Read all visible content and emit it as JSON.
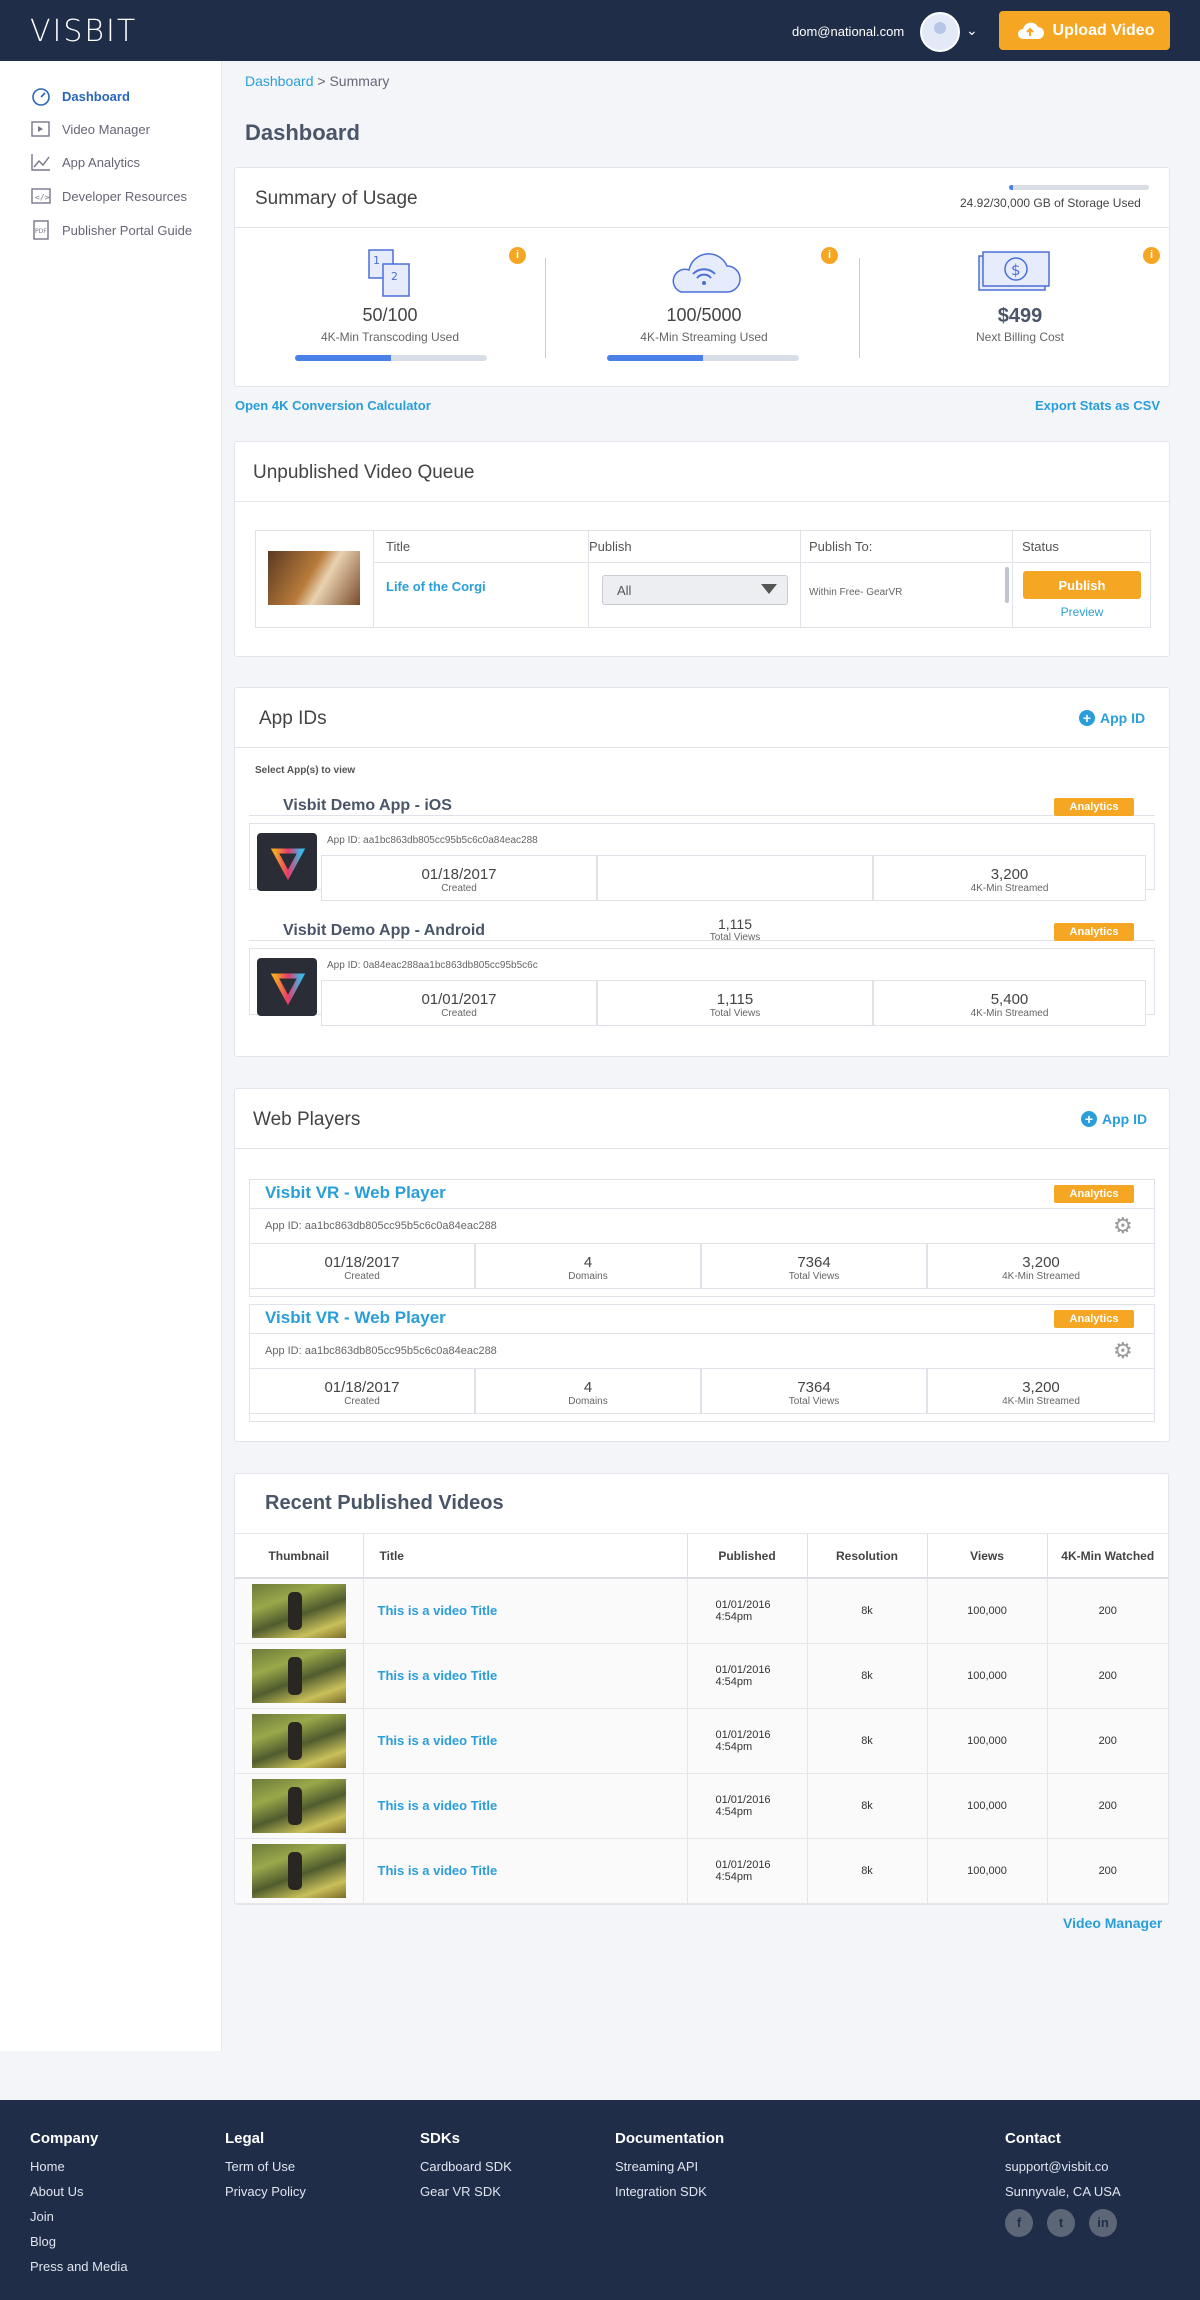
{
  "header": {
    "logo": "VISBIT",
    "email": "dom@national.com",
    "upload_label": "Upload Video"
  },
  "sidebar": {
    "items": [
      {
        "label": "Dashboard",
        "icon": "dashboard-gauge-icon"
      },
      {
        "label": "Video Manager",
        "icon": "video-icon"
      },
      {
        "label": "App Analytics",
        "icon": "chart-icon"
      },
      {
        "label": "Developer Resources",
        "icon": "code-icon"
      },
      {
        "label": "Publisher Portal Guide",
        "icon": "pdf-icon"
      }
    ]
  },
  "breadcrumb": {
    "link": "Dashboard",
    "sep": " > ",
    "current": "Summary"
  },
  "page_title": "Dashboard",
  "usage": {
    "title": "Summary of Usage",
    "storage_text": "24.92/30,000 GB of Storage Used",
    "storage_fraction": 0.03,
    "stats": [
      {
        "value": "50/100",
        "label": "4K-Min Transcoding Used",
        "fraction": 0.5,
        "icon": "transcode-icon"
      },
      {
        "value": "100/5000",
        "label": "4K-Min Streaming Used",
        "fraction": 0.5,
        "icon": "cloud-wifi-icon"
      },
      {
        "value": "$499",
        "label": "Next Billing Cost",
        "icon": "billing-icon"
      }
    ]
  },
  "links": {
    "calc": "Open 4K Conversion Calculator",
    "export": "Export Stats as CSV"
  },
  "queue": {
    "title": "Unpublished Video Queue",
    "headers": [
      "Title",
      "Publish",
      "Publish To:",
      "Status"
    ],
    "row": {
      "title": "Life of the Corgi",
      "publish": "All",
      "publish_to": "Within Free- GearVR",
      "status_btn": "Publish",
      "preview": "Preview"
    }
  },
  "app_ids": {
    "title": "App IDs",
    "add": "App ID",
    "select_label": "Select App(s) to view",
    "apps": [
      {
        "name": "Visbit Demo App - iOS",
        "analytics": "Analytics",
        "app_id": "App ID: aa1bc863db805cc95b5c6c0a84eac288",
        "created": "01/18/2017",
        "created_l": "Created",
        "mid": "",
        "mid_l": "",
        "streamed": "3,200",
        "streamed_l": "4K-Min Streamed"
      },
      {
        "name": "Visbit Demo App - Android",
        "analytics": "Analytics",
        "app_id": "App ID: 0a84eac288aa1bc863db805cc95b5c6c",
        "floating_views": "1,115",
        "floating_views_l": "Total Views",
        "created": "01/01/2017",
        "created_l": "Created",
        "mid": "1,115",
        "mid_l": "Total Views",
        "streamed": "5,400",
        "streamed_l": "4K-Min Streamed"
      }
    ]
  },
  "web_players": {
    "title": "Web Players",
    "add": "App ID",
    "players": [
      {
        "name": "Visbit VR - Web Player",
        "analytics": "Analytics",
        "app_id": "App ID: aa1bc863db805cc95b5c6c0a84eac288",
        "created": "01/18/2017",
        "created_l": "Created",
        "domains": "4",
        "domains_l": "Domains",
        "views": "7364",
        "views_l": "Total Views",
        "streamed": "3,200",
        "streamed_l": "4K-Min Streamed"
      },
      {
        "name": "Visbit VR - Web Player",
        "analytics": "Analytics",
        "app_id": "App ID: aa1bc863db805cc95b5c6c0a84eac288",
        "created": "01/18/2017",
        "created_l": "Created",
        "domains": "4",
        "domains_l": "Domains",
        "views": "7364",
        "views_l": "Total Views",
        "streamed": "3,200",
        "streamed_l": "4K-Min Streamed"
      }
    ]
  },
  "recent": {
    "title": "Recent Published Videos",
    "headers": [
      "Thumbnail",
      "Title",
      "Published",
      "Resolution",
      "Views",
      "4K-Min Watched"
    ],
    "rows": [
      {
        "title": "This is a video Title",
        "date": "01/01/2016",
        "time": "4:54pm",
        "res": "8k",
        "views": "100,000",
        "watched": "200"
      },
      {
        "title": "This is a video Title",
        "date": "01/01/2016",
        "time": "4:54pm",
        "res": "8k",
        "views": "100,000",
        "watched": "200"
      },
      {
        "title": "This is a video Title",
        "date": "01/01/2016",
        "time": "4:54pm",
        "res": "8k",
        "views": "100,000",
        "watched": "200"
      },
      {
        "title": "This is a video Title",
        "date": "01/01/2016",
        "time": "4:54pm",
        "res": "8k",
        "views": "100,000",
        "watched": "200"
      },
      {
        "title": "This is a video Title",
        "date": "01/01/2016",
        "time": "4:54pm",
        "res": "8k",
        "views": "100,000",
        "watched": "200"
      }
    ],
    "more": "Video Manager"
  },
  "footer": {
    "cols": [
      {
        "h": "Company",
        "items": [
          "Home",
          "About Us",
          "Join",
          "Blog",
          "Press and Media"
        ]
      },
      {
        "h": "Legal",
        "items": [
          "Term of Use",
          "Privacy Policy"
        ]
      },
      {
        "h": "SDKs",
        "items": [
          "Cardboard SDK",
          "Gear VR SDK"
        ]
      },
      {
        "h": "Documentation",
        "items": [
          "Streaming API",
          "Integration SDK"
        ]
      },
      {
        "h": "Contact",
        "items": [
          "support@visbit.co",
          "Sunnyvale, CA USA"
        ]
      }
    ],
    "social": [
      "facebook-icon",
      "twitter-icon",
      "linkedin-icon"
    ]
  },
  "colors": {
    "navy": "#1f2d48",
    "orange": "#f5a623",
    "link": "#2a9ed8",
    "bar": "#4a80e8"
  }
}
